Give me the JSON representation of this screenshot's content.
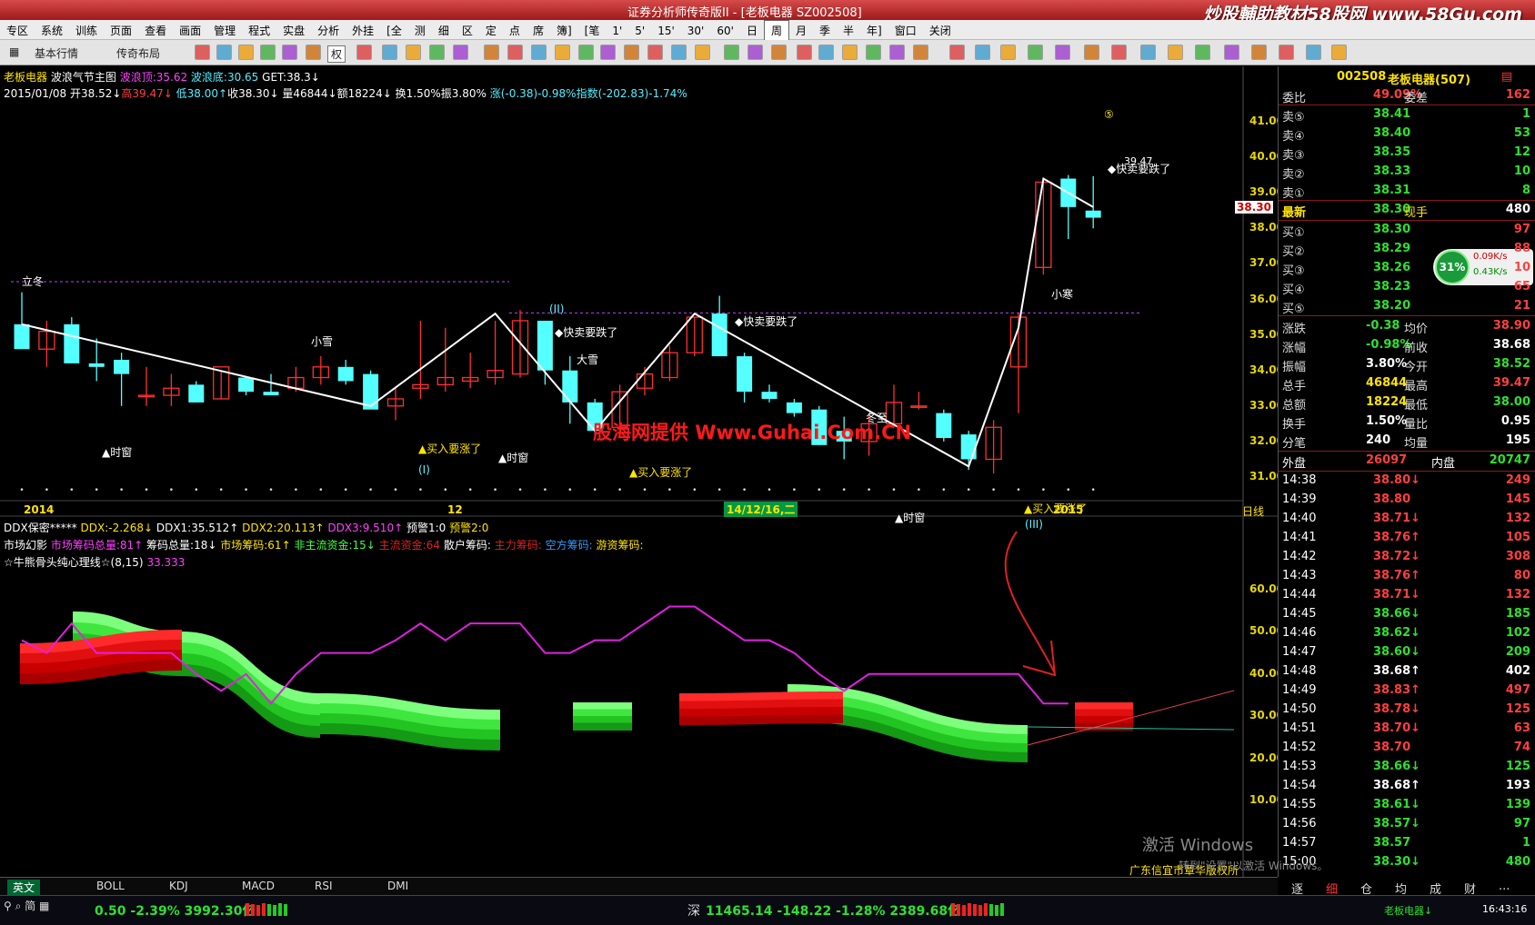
{
  "window": {
    "title": "证券分析师传奇版II - [老板电器 SZ002508]",
    "watermark": "炒股輔助教材58股网 www.58Gu.com"
  },
  "menu": [
    "专区",
    "系统",
    "训练",
    "页面",
    "查看",
    "画面",
    "管理",
    "程式",
    "实盘",
    "分析",
    "外挂",
    "[全",
    "测",
    "细",
    "区",
    "定",
    "点",
    "席",
    "簿]",
    "[笔",
    "1'",
    "5'",
    "15'",
    "30'",
    "60'",
    "日",
    "周",
    "月",
    "季",
    "半",
    "年]",
    "窗口",
    "关闭"
  ],
  "toolbar": {
    "market_label": "基本行情",
    "layout_label": "传奇布局",
    "quan_label": "权"
  },
  "main_chart": {
    "header": {
      "name": "老板电器",
      "indicator": "波浪气节主图",
      "wave_top_label": "波浪顶:35.62",
      "wave_bottom_label": "波浪底:30.65",
      "get_label": "GET:38.3↓"
    },
    "ohlc_line": {
      "date": "2015/01/08",
      "open": "开38.52↓",
      "high": "高39.47↓",
      "low": "低38.00↑",
      "close": "收38.30↓",
      "vol": "量46844↓",
      "amount": "额18224↓",
      "turnover": "换1.50%",
      "amplitude": "振3.80%",
      "change": "涨(-0.38)-0.98%",
      "index": "指数(-202.83)-1.74%"
    },
    "y_axis": [
      "41.00",
      "40.00",
      "39.00",
      "38.00",
      "37.00",
      "36.00",
      "35.00",
      "34.00",
      "33.00",
      "32.00",
      "31.00"
    ],
    "current_price_tag": "38.30",
    "x_axis": {
      "start": "2014",
      "mid": "12",
      "cursor": "14/12/16,二",
      "end": "2015",
      "period": "日线"
    },
    "annotations": {
      "lidong": "立冬",
      "xiaoxue": "小雪",
      "daxue": "大雪",
      "dongzhi": "冬至",
      "xiaohan": "小寒",
      "time_window": "▲时窗",
      "buy_signal": "▲买入要涨了",
      "sell_signal": "◆快卖要跌了",
      "wave1": "(I)",
      "wave2": "(II)",
      "wave3": "(III)",
      "wave5": "⑤",
      "high_price": "39.47",
      "watermark": "股海网提供 Www.Guhai.Com.CN"
    },
    "candles": [
      {
        "o": 35.3,
        "h": 36.2,
        "l": 34.9,
        "c": 34.6
      },
      {
        "o": 34.6,
        "h": 35.4,
        "l": 34.1,
        "c": 35.1
      },
      {
        "o": 35.3,
        "h": 35.5,
        "l": 34.3,
        "c": 34.2
      },
      {
        "o": 34.2,
        "h": 34.9,
        "l": 33.7,
        "c": 34.1
      },
      {
        "o": 34.3,
        "h": 34.5,
        "l": 33.0,
        "c": 33.9
      },
      {
        "o": 33.3,
        "h": 34.1,
        "l": 33.0,
        "c": 33.3
      },
      {
        "o": 33.3,
        "h": 33.9,
        "l": 33.0,
        "c": 33.5
      },
      {
        "o": 33.6,
        "h": 33.7,
        "l": 33.1,
        "c": 33.1
      },
      {
        "o": 33.2,
        "h": 34.0,
        "l": 33.2,
        "c": 34.1
      },
      {
        "o": 33.8,
        "h": 33.8,
        "l": 33.3,
        "c": 33.4
      },
      {
        "o": 33.4,
        "h": 33.9,
        "l": 33.3,
        "c": 33.3
      },
      {
        "o": 33.5,
        "h": 34.1,
        "l": 33.4,
        "c": 33.8
      },
      {
        "o": 33.8,
        "h": 34.4,
        "l": 33.6,
        "c": 34.1
      },
      {
        "o": 34.1,
        "h": 34.3,
        "l": 33.6,
        "c": 33.7
      },
      {
        "o": 33.9,
        "h": 34.0,
        "l": 33.0,
        "c": 32.9
      },
      {
        "o": 33.0,
        "h": 33.5,
        "l": 32.6,
        "c": 33.2
      },
      {
        "o": 33.5,
        "h": 35.4,
        "l": 33.2,
        "c": 33.6
      },
      {
        "o": 33.6,
        "h": 35.2,
        "l": 33.4,
        "c": 33.8
      },
      {
        "o": 33.7,
        "h": 34.5,
        "l": 33.5,
        "c": 33.8
      },
      {
        "o": 33.8,
        "h": 35.4,
        "l": 33.6,
        "c": 34.0
      },
      {
        "o": 33.9,
        "h": 35.7,
        "l": 33.8,
        "c": 35.4
      },
      {
        "o": 35.4,
        "h": 35.4,
        "l": 33.6,
        "c": 34.0
      },
      {
        "o": 34.0,
        "h": 34.4,
        "l": 32.5,
        "c": 33.1
      },
      {
        "o": 33.1,
        "h": 33.2,
        "l": 32.1,
        "c": 32.3
      },
      {
        "o": 32.4,
        "h": 33.6,
        "l": 32.3,
        "c": 33.4
      },
      {
        "o": 33.5,
        "h": 34.1,
        "l": 33.3,
        "c": 33.9
      },
      {
        "o": 33.8,
        "h": 34.7,
        "l": 33.7,
        "c": 34.5
      },
      {
        "o": 34.5,
        "h": 35.5,
        "l": 34.4,
        "c": 35.5
      },
      {
        "o": 35.6,
        "h": 36.1,
        "l": 34.6,
        "c": 34.4
      },
      {
        "o": 34.4,
        "h": 34.5,
        "l": 33.1,
        "c": 33.4
      },
      {
        "o": 33.4,
        "h": 33.6,
        "l": 33.1,
        "c": 33.2
      },
      {
        "o": 33.1,
        "h": 33.2,
        "l": 32.7,
        "c": 32.8
      },
      {
        "o": 32.9,
        "h": 33.0,
        "l": 31.9,
        "c": 31.9
      },
      {
        "o": 32.3,
        "h": 32.7,
        "l": 31.5,
        "c": 32.0
      },
      {
        "o": 32.0,
        "h": 32.8,
        "l": 31.6,
        "c": 32.5
      },
      {
        "o": 32.5,
        "h": 33.6,
        "l": 32.4,
        "c": 33.1
      },
      {
        "o": 33.0,
        "h": 33.4,
        "l": 32.9,
        "c": 33.0
      },
      {
        "o": 32.8,
        "h": 32.9,
        "l": 32.0,
        "c": 32.1
      },
      {
        "o": 32.2,
        "h": 32.3,
        "l": 31.2,
        "c": 31.5
      },
      {
        "o": 31.5,
        "h": 32.6,
        "l": 31.1,
        "c": 32.4
      },
      {
        "o": 34.1,
        "h": 35.6,
        "l": 32.8,
        "c": 35.5
      },
      {
        "o": 36.9,
        "h": 39.4,
        "l": 36.7,
        "c": 39.3
      },
      {
        "o": 39.4,
        "h": 39.5,
        "l": 37.7,
        "c": 38.6
      },
      {
        "o": 38.5,
        "h": 39.47,
        "l": 38.0,
        "c": 38.3
      }
    ],
    "wave_line": [
      [
        0,
        35.3
      ],
      [
        14,
        33.0
      ],
      [
        19,
        35.6
      ],
      [
        23,
        32.3
      ],
      [
        27,
        35.6
      ],
      [
        38,
        31.3
      ],
      [
        40,
        35.2
      ],
      [
        41,
        39.4
      ],
      [
        43,
        38.6
      ]
    ],
    "top_band": "35.62",
    "bottom_band": "30.65",
    "lidong_band": "36.5"
  },
  "sub_chart": {
    "line1": {
      "name": "DDX保密*****",
      "ddx": "DDX:-2.268↓",
      "ddx1": "DDX1:35.512↑",
      "ddx2": "DDX2:20.113↑",
      "ddx3": "DDX3:9.510↑",
      "warn1": "预警1:0",
      "warn2": "预警2:0"
    },
    "line2": {
      "name": "市场幻影",
      "total": "市场筹码总量:81↑",
      "chip": "筹码总量:18↓",
      "market_chip": "市场筹码:61↑",
      "nonmain": "非主流资金:15↓",
      "main": "主流资金:64",
      "retail": "散户筹码:",
      "mainchip": "主力筹码:",
      "empty": "空方筹码:",
      "hot": "游资筹码:"
    },
    "line3": {
      "name": "☆牛熊骨头纯心理线☆(8,15)",
      "value": "33.333"
    },
    "y_axis": [
      "60.00",
      "50.00",
      "40.00",
      "30.00",
      "20.00",
      "10.00"
    ],
    "psy_line": [
      48,
      45,
      52,
      45,
      45,
      45,
      45,
      40,
      36,
      40,
      33,
      40,
      45,
      45,
      45,
      48,
      52,
      48,
      52,
      52,
      52,
      45,
      45,
      48,
      48,
      52,
      56,
      56,
      52,
      48,
      48,
      45,
      40,
      36,
      40,
      40,
      40,
      40,
      40,
      40,
      40,
      33,
      33
    ],
    "footer": "广东信宜市覃华版权所"
  },
  "panel": {
    "code": "002508",
    "name": "老板电器(507)",
    "weibi_label": "委比",
    "weibi": "49.09%",
    "weicha_label": "委差",
    "weicha": "162",
    "asks": [
      {
        "l": "卖⑤",
        "p": "38.41",
        "v": "1"
      },
      {
        "l": "卖④",
        "p": "38.40",
        "v": "53"
      },
      {
        "l": "卖③",
        "p": "38.35",
        "v": "12"
      },
      {
        "l": "卖②",
        "p": "38.33",
        "v": "10"
      },
      {
        "l": "卖①",
        "p": "38.31",
        "v": "8"
      }
    ],
    "last": {
      "l": "最新",
      "p": "38.30",
      "l2": "现手",
      "v": "480"
    },
    "bids": [
      {
        "l": "买①",
        "p": "38.30",
        "v": "97"
      },
      {
        "l": "买②",
        "p": "38.29",
        "v": "88"
      },
      {
        "l": "买③",
        "p": "38.26",
        "v": "10"
      },
      {
        "l": "买④",
        "p": "38.23",
        "v": "65"
      },
      {
        "l": "买⑤",
        "p": "38.20",
        "v": "21"
      }
    ],
    "stats": [
      {
        "l1": "涨跌",
        "v1": "-0.38",
        "l2": "均价",
        "v2": "38.90",
        "c1": "#2fe02f",
        "c2": "#ff4040"
      },
      {
        "l1": "涨幅",
        "v1": "-0.98%",
        "l2": "前收",
        "v2": "38.68",
        "c1": "#2fe02f",
        "c2": "#fff"
      },
      {
        "l1": "振幅",
        "v1": "3.80%",
        "l2": "今开",
        "v2": "38.52",
        "c1": "#fff",
        "c2": "#2fe02f"
      },
      {
        "l1": "总手",
        "v1": "46844",
        "l2": "最高",
        "v2": "39.47",
        "c1": "#ffe400",
        "c2": "#ff4040"
      },
      {
        "l1": "总额",
        "v1": "18224",
        "l2": "最低",
        "v2": "38.00",
        "c1": "#ffe400",
        "c2": "#2fe02f"
      },
      {
        "l1": "换手",
        "v1": "1.50%",
        "l2": "量比",
        "v2": "0.95",
        "c1": "#fff",
        "c2": "#fff"
      },
      {
        "l1": "分笔",
        "v1": "240",
        "l2": "均量",
        "v2": "195",
        "c1": "#fff",
        "c2": "#fff"
      }
    ],
    "outer": {
      "l": "外盘",
      "v": "26097",
      "l2": "内盘",
      "v2": "20747"
    },
    "badge": {
      "pct": "31%",
      "up": "0.09K/s",
      "down": "0.43K/s"
    },
    "ticks": [
      {
        "t": "14:38",
        "p": "38.80↓",
        "v": "249",
        "c": "#ff4040"
      },
      {
        "t": "14:39",
        "p": "38.80",
        "v": "145",
        "c": "#ff4040"
      },
      {
        "t": "14:40",
        "p": "38.71↓",
        "v": "132",
        "c": "#ff4040"
      },
      {
        "t": "14:41",
        "p": "38.76↑",
        "v": "105",
        "c": "#ff4040"
      },
      {
        "t": "14:42",
        "p": "38.72↓",
        "v": "308",
        "c": "#ff4040"
      },
      {
        "t": "14:43",
        "p": "38.76↑",
        "v": "80",
        "c": "#ff4040"
      },
      {
        "t": "14:44",
        "p": "38.71↓",
        "v": "132",
        "c": "#ff4040"
      },
      {
        "t": "14:45",
        "p": "38.66↓",
        "v": "185",
        "c": "#2fe02f"
      },
      {
        "t": "14:46",
        "p": "38.62↓",
        "v": "102",
        "c": "#2fe02f"
      },
      {
        "t": "14:47",
        "p": "38.60↓",
        "v": "209",
        "c": "#2fe02f"
      },
      {
        "t": "14:48",
        "p": "38.68↑",
        "v": "402",
        "c": "#fff"
      },
      {
        "t": "14:49",
        "p": "38.83↑",
        "v": "497",
        "c": "#ff4040"
      },
      {
        "t": "14:50",
        "p": "38.78↓",
        "v": "125",
        "c": "#ff4040"
      },
      {
        "t": "14:51",
        "p": "38.70↓",
        "v": "63",
        "c": "#ff4040"
      },
      {
        "t": "14:52",
        "p": "38.70",
        "v": "74",
        "c": "#ff4040"
      },
      {
        "t": "14:53",
        "p": "38.66↓",
        "v": "125",
        "c": "#2fe02f"
      },
      {
        "t": "14:54",
        "p": "38.68↑",
        "v": "193",
        "c": "#fff"
      },
      {
        "t": "14:55",
        "p": "38.61↓",
        "v": "139",
        "c": "#2fe02f"
      },
      {
        "t": "14:56",
        "p": "38.57↓",
        "v": "97",
        "c": "#2fe02f"
      },
      {
        "t": "14:57",
        "p": "38.57",
        "v": "1",
        "c": "#2fe02f"
      },
      {
        "t": "15:00",
        "p": "38.30↓",
        "v": "480",
        "c": "#2fe02f"
      }
    ],
    "tabs": [
      "逐",
      "细",
      "仓",
      "均",
      "成",
      "财",
      "..."
    ]
  },
  "bottom_tabs": [
    "BOLL",
    "KDJ",
    "MACD",
    "RSI",
    "DMI"
  ],
  "ime": "英文",
  "status": {
    "sh": "0.50 -2.39% 3992.30亿",
    "sz_label": "深",
    "sz": "11465.14 -148.22 -1.28% 2389.68亿",
    "stock": "老板电器↓",
    "time": "16:43:16",
    "activate": "激活 Windows",
    "activate_sub": "转到\"设置\"以激活 Windows。"
  },
  "colors": {
    "up": "#ff3030",
    "down": "#54ffff",
    "wave": "#ffffff",
    "band": "#c040ff",
    "psy": "#e020e0"
  }
}
